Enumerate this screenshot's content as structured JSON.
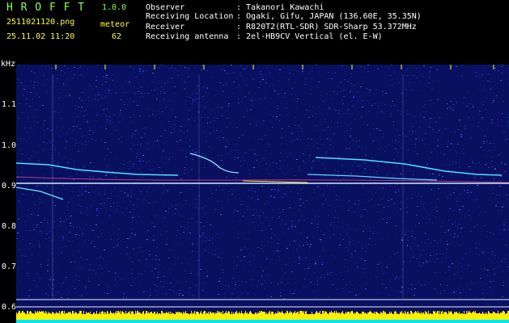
{
  "header": {
    "app_name": "H R O F F T",
    "version": "1.0.0",
    "filename": "2511021120.png",
    "timestamp": "25.11.02 11:20",
    "meteor_label": "meteor",
    "meteor_count": "62"
  },
  "info": [
    {
      "label": "Observer",
      "value": ": Takanori Kawachi"
    },
    {
      "label": "Receiving Location",
      "value": ": Ogaki, Gifu, JAPAN (136.60E, 35.35N)"
    },
    {
      "label": "Receiver",
      "value": ": R820T2(RTL-SDR) SDR-Sharp 53.372MHz"
    },
    {
      "label": "Receiving antenna",
      "value": ": 2el-HB9CV Vertical (el. E-W)"
    }
  ],
  "axes": {
    "y_unit": "kHz",
    "y_ticks": [
      "1.1",
      "1.0",
      "0.9",
      "0.8",
      "0.7",
      "0.6"
    ],
    "x_ticks": [
      "1121",
      "1122",
      "1123",
      "1124",
      "1125",
      "1126",
      "1127",
      "1128",
      "1129",
      "1130"
    ]
  },
  "colors": {
    "background": "#000000",
    "noise": "#1a2a9a",
    "label_green": "#8cff5a",
    "tick_yellow": "#ffff33",
    "baseline": "#ffee00",
    "baseline_cyan": "#00e5ff"
  }
}
